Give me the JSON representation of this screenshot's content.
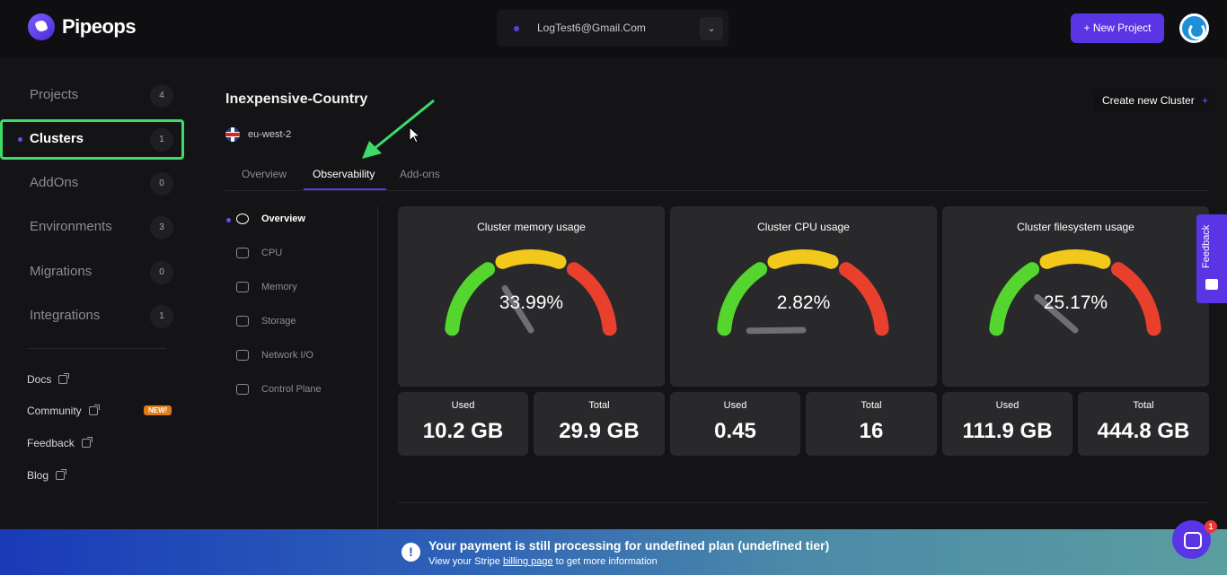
{
  "header": {
    "brand": "Pipeops",
    "account_email": "LogTest6@Gmail.Com",
    "new_project_label": "+ New Project"
  },
  "sidebar": {
    "items": [
      {
        "label": "Projects",
        "count": "4"
      },
      {
        "label": "Clusters",
        "count": "1"
      },
      {
        "label": "AddOns",
        "count": "0"
      },
      {
        "label": "Environments",
        "count": "3"
      },
      {
        "label": "Migrations",
        "count": "0"
      },
      {
        "label": "Integrations",
        "count": "1"
      }
    ],
    "links": [
      {
        "label": "Docs"
      },
      {
        "label": "Community",
        "badge": "NEW!"
      },
      {
        "label": "Feedback"
      },
      {
        "label": "Blog"
      }
    ]
  },
  "main": {
    "cluster_name": "Inexpensive-Country",
    "region": "eu-west-2",
    "create_cluster_label": "Create new Cluster",
    "create_cluster_plus": "+",
    "tabs": [
      "Overview",
      "Observability",
      "Add-ons"
    ],
    "subnav": [
      "Overview",
      "CPU",
      "Memory",
      "Storage",
      "Network I/O",
      "Control Plane"
    ],
    "gauges": [
      {
        "title": "Cluster memory usage",
        "percent_label": "33.99%",
        "percent": 33.99,
        "used_label": "Used",
        "used": "10.2 GB",
        "total_label": "Total",
        "total": "29.9 GB"
      },
      {
        "title": "Cluster CPU usage",
        "percent_label": "2.82%",
        "percent": 2.82,
        "used_label": "Used",
        "used": "0.45",
        "total_label": "Total",
        "total": "16"
      },
      {
        "title": "Cluster filesystem usage",
        "percent_label": "25.17%",
        "percent": 25.17,
        "used_label": "Used",
        "used": "111.9 GB",
        "total_label": "Total",
        "total": "444.8 GB"
      }
    ]
  },
  "feedback_tab": "Feedback",
  "banner": {
    "title": "Your payment is still processing for undefined plan (undefined tier)",
    "text_before": "View your Stripe ",
    "link": "billing page",
    "text_after": " to get more information",
    "warn_glyph": "!"
  },
  "chat_badge": "1",
  "colors": {
    "accent": "#5a35e6",
    "highlight": "#3ddc6a",
    "gauge_green": "#55d62e",
    "gauge_yellow": "#f2c81a",
    "gauge_red": "#e8402c"
  }
}
